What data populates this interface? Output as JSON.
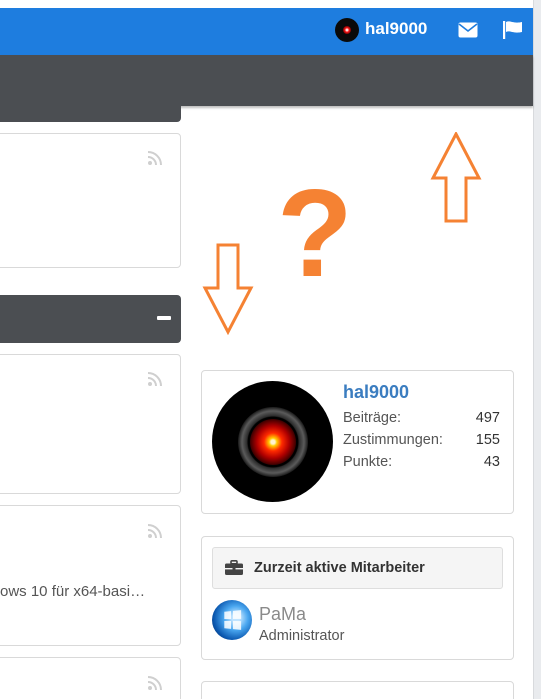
{
  "topbar": {
    "username": "hal9000",
    "colors": {
      "bar": "#1e7ddf",
      "nav": "#4b4e52"
    },
    "icons": [
      "user-avatar",
      "envelope-icon",
      "flag-icon"
    ]
  },
  "feed": {
    "snippet": "ows 10 für x64-basi…",
    "collapse_icon": "minus-icon",
    "rss_icon": "rss-icon"
  },
  "profile": {
    "name": "hal9000",
    "stats": [
      {
        "label": "Beiträge:",
        "value": "497"
      },
      {
        "label": "Zustimmungen:",
        "value": "155"
      },
      {
        "label": "Punkte:",
        "value": "43"
      }
    ]
  },
  "staff_widget": {
    "title": "Zurzeit aktive Mitarbeiter",
    "members": [
      {
        "name": "PaMa",
        "role": "Administrator"
      }
    ]
  },
  "annotations": {
    "symbol": "?",
    "color": "#f58233"
  }
}
